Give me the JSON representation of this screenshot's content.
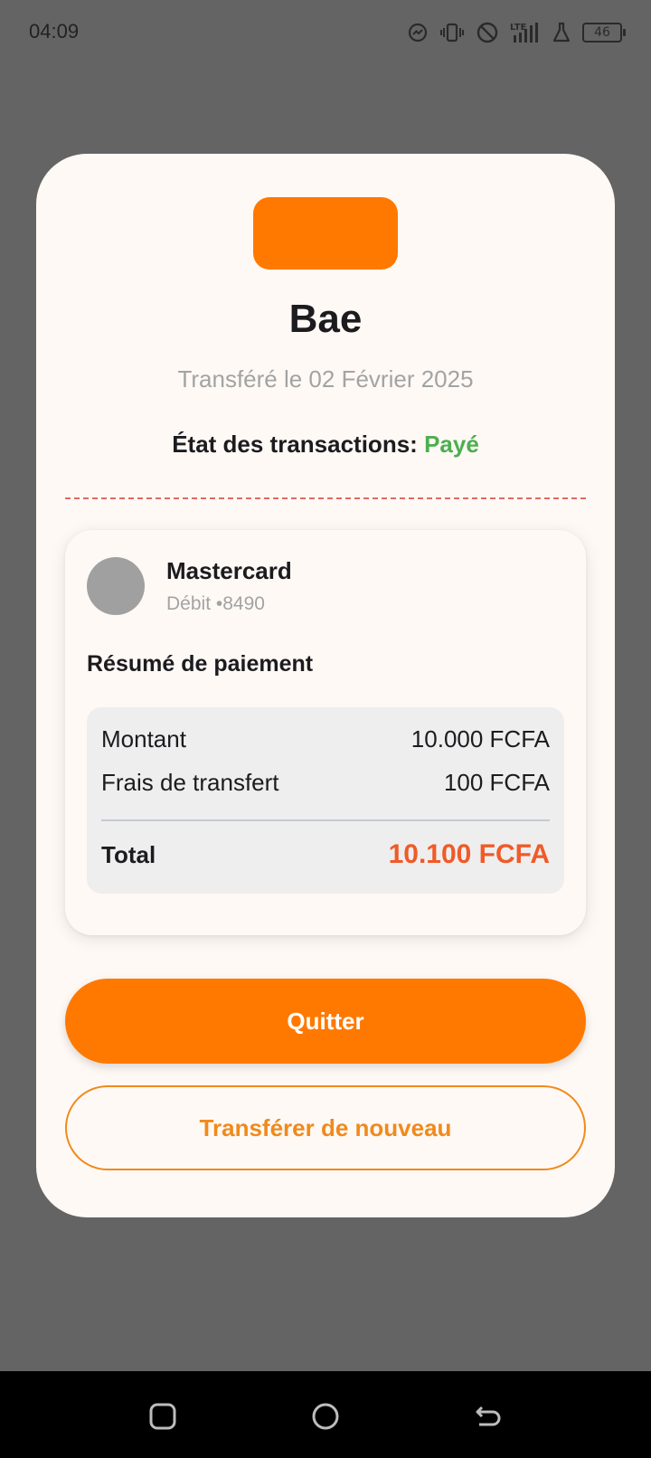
{
  "status_bar": {
    "time": "04:09",
    "battery_level": "46",
    "icons": [
      "messenger-icon",
      "vibrate-icon",
      "do-not-disturb-icon",
      "lte-signal-icon",
      "lab-flask-icon",
      "battery-icon"
    ]
  },
  "transaction": {
    "recipient": "Bae",
    "date_text": "Transféré le 02 Février 2025",
    "status_label": "État des transactions:",
    "status_value": "Payé"
  },
  "payment_method": {
    "name": "Mastercard",
    "detail": "Débit •8490"
  },
  "summary": {
    "title": "Résumé de paiement",
    "rows": [
      {
        "label": "Montant",
        "value": "10.000 FCFA"
      },
      {
        "label": "Frais de transfert",
        "value": "100 FCFA"
      }
    ],
    "total_label": "Total",
    "total_value": "10.100 FCFA"
  },
  "actions": {
    "quit_label": "Quitter",
    "transfer_again_label": "Transférer de nouveau"
  },
  "colors": {
    "accent": "#ff7900",
    "success": "#4caf50",
    "total": "#f05a28",
    "card_bg": "#fff9f5",
    "overlay": "#646464"
  },
  "nav_bar": {
    "buttons": [
      "recent-apps-icon",
      "home-icon",
      "back-icon"
    ]
  }
}
